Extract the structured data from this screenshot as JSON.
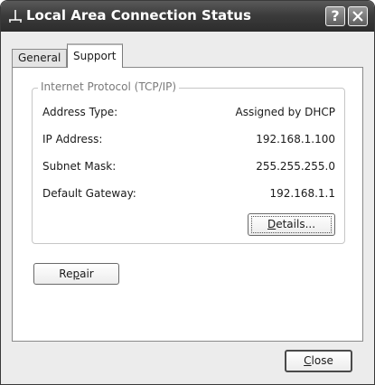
{
  "window": {
    "title": "Local Area Connection Status",
    "icon": "network-connection-icon",
    "help_glyph": "?"
  },
  "tabs": [
    {
      "label": "General",
      "active": false
    },
    {
      "label": "Support",
      "active": true
    }
  ],
  "support": {
    "group_title": "Internet Protocol (TCP/IP)",
    "rows": [
      {
        "label": "Address Type:",
        "value": "Assigned by DHCP"
      },
      {
        "label": "IP Address:",
        "value": "192.168.1.100"
      },
      {
        "label": "Subnet Mask:",
        "value": "255.255.255.0"
      },
      {
        "label": "Default Gateway:",
        "value": "192.168.1.1"
      }
    ],
    "details_button": {
      "pre": "",
      "mnemonic": "D",
      "post": "etails..."
    },
    "repair_button": {
      "pre": "Re",
      "mnemonic": "p",
      "post": "air"
    }
  },
  "footer": {
    "close_button": {
      "pre": "",
      "mnemonic": "C",
      "post": "lose"
    }
  }
}
